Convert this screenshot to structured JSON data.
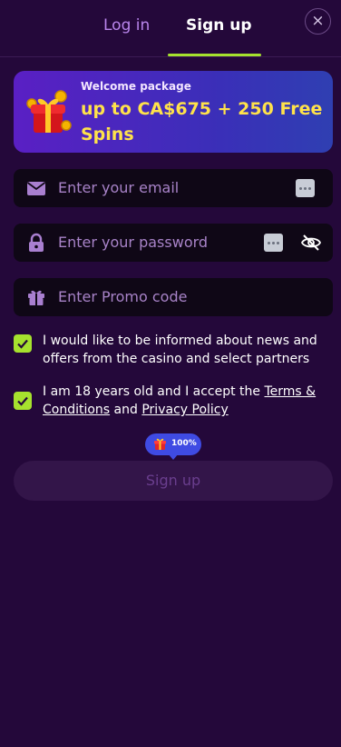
{
  "tabs": {
    "login": "Log in",
    "signup": "Sign up",
    "active": "signup"
  },
  "close": {
    "label": "×"
  },
  "banner": {
    "subtitle": "Welcome package",
    "title": "up to CA$675 + 250 Free Spins",
    "icon": "gift-box-with-coins"
  },
  "fields": {
    "email": {
      "placeholder": "Enter your email",
      "icon": "envelope-icon"
    },
    "password": {
      "placeholder": "Enter your password",
      "icon": "lock-icon",
      "visibility_icon": "eye-off-icon"
    },
    "promo": {
      "placeholder": "Enter Promo code",
      "icon": "gift-icon"
    }
  },
  "consents": {
    "news": {
      "checked": true,
      "text": "I would like to be informed about news and offers from the casino and select partners"
    },
    "age": {
      "checked": true,
      "text_before": "I am 18 years old and I accept the ",
      "terms_link": "Terms & Conditions",
      "text_between": " and ",
      "privacy_link": "Privacy Policy"
    }
  },
  "bonus_pill": {
    "label": "100%"
  },
  "submit": {
    "label": "Sign up"
  },
  "colors": {
    "background": "#24083a",
    "accent_green": "#a6e22e",
    "banner_title": "#ffe24a",
    "tab_inactive": "#b985ec",
    "pill_blue": "#3f4be3"
  }
}
